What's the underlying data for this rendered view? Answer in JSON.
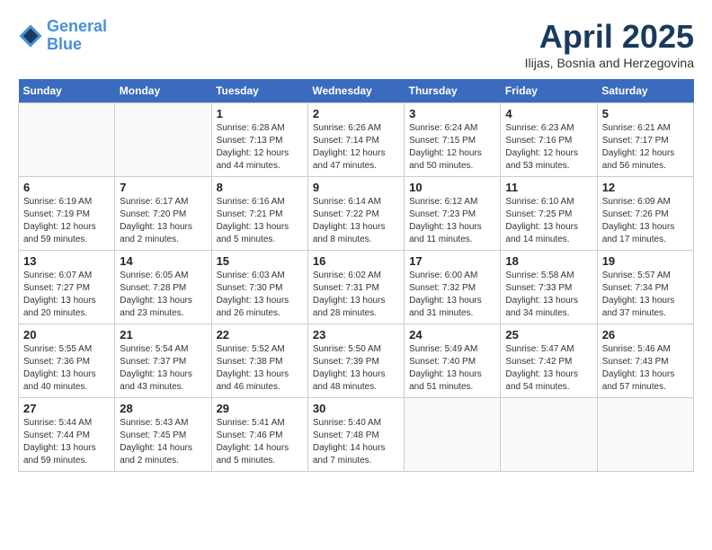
{
  "header": {
    "logo_line1": "General",
    "logo_line2": "Blue",
    "month_title": "April 2025",
    "subtitle": "Ilijas, Bosnia and Herzegovina"
  },
  "weekdays": [
    "Sunday",
    "Monday",
    "Tuesday",
    "Wednesday",
    "Thursday",
    "Friday",
    "Saturday"
  ],
  "weeks": [
    [
      {
        "day": "",
        "sunrise": "",
        "sunset": "",
        "daylight": ""
      },
      {
        "day": "",
        "sunrise": "",
        "sunset": "",
        "daylight": ""
      },
      {
        "day": "1",
        "sunrise": "Sunrise: 6:28 AM",
        "sunset": "Sunset: 7:13 PM",
        "daylight": "Daylight: 12 hours and 44 minutes."
      },
      {
        "day": "2",
        "sunrise": "Sunrise: 6:26 AM",
        "sunset": "Sunset: 7:14 PM",
        "daylight": "Daylight: 12 hours and 47 minutes."
      },
      {
        "day": "3",
        "sunrise": "Sunrise: 6:24 AM",
        "sunset": "Sunset: 7:15 PM",
        "daylight": "Daylight: 12 hours and 50 minutes."
      },
      {
        "day": "4",
        "sunrise": "Sunrise: 6:23 AM",
        "sunset": "Sunset: 7:16 PM",
        "daylight": "Daylight: 12 hours and 53 minutes."
      },
      {
        "day": "5",
        "sunrise": "Sunrise: 6:21 AM",
        "sunset": "Sunset: 7:17 PM",
        "daylight": "Daylight: 12 hours and 56 minutes."
      }
    ],
    [
      {
        "day": "6",
        "sunrise": "Sunrise: 6:19 AM",
        "sunset": "Sunset: 7:19 PM",
        "daylight": "Daylight: 12 hours and 59 minutes."
      },
      {
        "day": "7",
        "sunrise": "Sunrise: 6:17 AM",
        "sunset": "Sunset: 7:20 PM",
        "daylight": "Daylight: 13 hours and 2 minutes."
      },
      {
        "day": "8",
        "sunrise": "Sunrise: 6:16 AM",
        "sunset": "Sunset: 7:21 PM",
        "daylight": "Daylight: 13 hours and 5 minutes."
      },
      {
        "day": "9",
        "sunrise": "Sunrise: 6:14 AM",
        "sunset": "Sunset: 7:22 PM",
        "daylight": "Daylight: 13 hours and 8 minutes."
      },
      {
        "day": "10",
        "sunrise": "Sunrise: 6:12 AM",
        "sunset": "Sunset: 7:23 PM",
        "daylight": "Daylight: 13 hours and 11 minutes."
      },
      {
        "day": "11",
        "sunrise": "Sunrise: 6:10 AM",
        "sunset": "Sunset: 7:25 PM",
        "daylight": "Daylight: 13 hours and 14 minutes."
      },
      {
        "day": "12",
        "sunrise": "Sunrise: 6:09 AM",
        "sunset": "Sunset: 7:26 PM",
        "daylight": "Daylight: 13 hours and 17 minutes."
      }
    ],
    [
      {
        "day": "13",
        "sunrise": "Sunrise: 6:07 AM",
        "sunset": "Sunset: 7:27 PM",
        "daylight": "Daylight: 13 hours and 20 minutes."
      },
      {
        "day": "14",
        "sunrise": "Sunrise: 6:05 AM",
        "sunset": "Sunset: 7:28 PM",
        "daylight": "Daylight: 13 hours and 23 minutes."
      },
      {
        "day": "15",
        "sunrise": "Sunrise: 6:03 AM",
        "sunset": "Sunset: 7:30 PM",
        "daylight": "Daylight: 13 hours and 26 minutes."
      },
      {
        "day": "16",
        "sunrise": "Sunrise: 6:02 AM",
        "sunset": "Sunset: 7:31 PM",
        "daylight": "Daylight: 13 hours and 28 minutes."
      },
      {
        "day": "17",
        "sunrise": "Sunrise: 6:00 AM",
        "sunset": "Sunset: 7:32 PM",
        "daylight": "Daylight: 13 hours and 31 minutes."
      },
      {
        "day": "18",
        "sunrise": "Sunrise: 5:58 AM",
        "sunset": "Sunset: 7:33 PM",
        "daylight": "Daylight: 13 hours and 34 minutes."
      },
      {
        "day": "19",
        "sunrise": "Sunrise: 5:57 AM",
        "sunset": "Sunset: 7:34 PM",
        "daylight": "Daylight: 13 hours and 37 minutes."
      }
    ],
    [
      {
        "day": "20",
        "sunrise": "Sunrise: 5:55 AM",
        "sunset": "Sunset: 7:36 PM",
        "daylight": "Daylight: 13 hours and 40 minutes."
      },
      {
        "day": "21",
        "sunrise": "Sunrise: 5:54 AM",
        "sunset": "Sunset: 7:37 PM",
        "daylight": "Daylight: 13 hours and 43 minutes."
      },
      {
        "day": "22",
        "sunrise": "Sunrise: 5:52 AM",
        "sunset": "Sunset: 7:38 PM",
        "daylight": "Daylight: 13 hours and 46 minutes."
      },
      {
        "day": "23",
        "sunrise": "Sunrise: 5:50 AM",
        "sunset": "Sunset: 7:39 PM",
        "daylight": "Daylight: 13 hours and 48 minutes."
      },
      {
        "day": "24",
        "sunrise": "Sunrise: 5:49 AM",
        "sunset": "Sunset: 7:40 PM",
        "daylight": "Daylight: 13 hours and 51 minutes."
      },
      {
        "day": "25",
        "sunrise": "Sunrise: 5:47 AM",
        "sunset": "Sunset: 7:42 PM",
        "daylight": "Daylight: 13 hours and 54 minutes."
      },
      {
        "day": "26",
        "sunrise": "Sunrise: 5:46 AM",
        "sunset": "Sunset: 7:43 PM",
        "daylight": "Daylight: 13 hours and 57 minutes."
      }
    ],
    [
      {
        "day": "27",
        "sunrise": "Sunrise: 5:44 AM",
        "sunset": "Sunset: 7:44 PM",
        "daylight": "Daylight: 13 hours and 59 minutes."
      },
      {
        "day": "28",
        "sunrise": "Sunrise: 5:43 AM",
        "sunset": "Sunset: 7:45 PM",
        "daylight": "Daylight: 14 hours and 2 minutes."
      },
      {
        "day": "29",
        "sunrise": "Sunrise: 5:41 AM",
        "sunset": "Sunset: 7:46 PM",
        "daylight": "Daylight: 14 hours and 5 minutes."
      },
      {
        "day": "30",
        "sunrise": "Sunrise: 5:40 AM",
        "sunset": "Sunset: 7:48 PM",
        "daylight": "Daylight: 14 hours and 7 minutes."
      },
      {
        "day": "",
        "sunrise": "",
        "sunset": "",
        "daylight": ""
      },
      {
        "day": "",
        "sunrise": "",
        "sunset": "",
        "daylight": ""
      },
      {
        "day": "",
        "sunrise": "",
        "sunset": "",
        "daylight": ""
      }
    ]
  ]
}
